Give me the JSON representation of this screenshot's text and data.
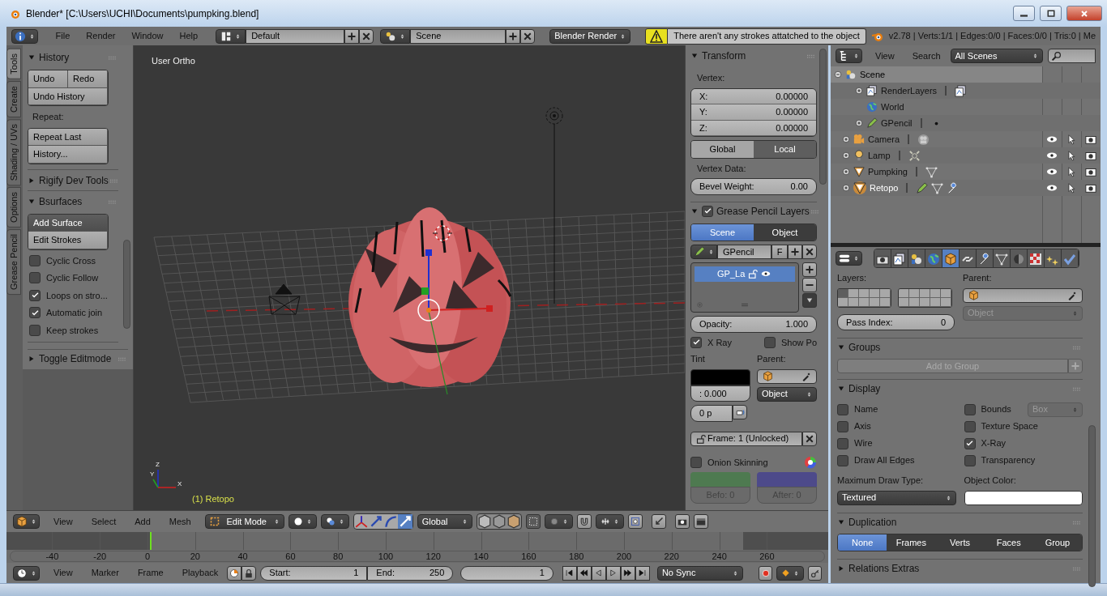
{
  "window": {
    "title": "Blender* [C:\\Users\\UCHI\\Documents\\pumpking.blend]"
  },
  "info_header": {
    "menus": [
      "File",
      "Render",
      "Window",
      "Help"
    ],
    "layout": "Default",
    "scene": "Scene",
    "engine": "Blender Render",
    "warning": "There aren't any strokes attatched to the object",
    "stats": "v2.78 | Verts:1/1 | Edges:0/0 | Faces:0/0 | Tris:0 | Me"
  },
  "tool_shelf": {
    "tabs": [
      {
        "label": "Tools",
        "selected": true
      },
      {
        "label": "Create",
        "selected": false
      },
      {
        "label": "Shading / UVs",
        "selected": false
      },
      {
        "label": "Options",
        "selected": false
      },
      {
        "label": "Grease Pencil",
        "selected": false
      }
    ],
    "panels": [
      {
        "title": "History",
        "expanded": true,
        "items": [
          {
            "kind": "buttons",
            "rows": [
              [
                "Undo",
                "Redo"
              ],
              [
                "Undo History"
              ]
            ]
          },
          {
            "kind": "label",
            "text": "Repeat:"
          },
          {
            "kind": "buttons",
            "rows": [
              [
                "Repeat Last"
              ],
              [
                "History..."
              ]
            ]
          }
        ]
      },
      {
        "title": "Rigify Dev Tools",
        "expanded": false
      },
      {
        "title": "Bsurfaces",
        "expanded": true,
        "items": [
          {
            "kind": "buttons",
            "rows": [
              [
                "Add Surface"
              ],
              [
                "Edit Strokes"
              ]
            ]
          },
          {
            "kind": "checkbox",
            "label": "Cyclic Cross",
            "checked": false
          },
          {
            "kind": "checkbox",
            "label": "Cyclic Follow",
            "checked": false
          },
          {
            "kind": "checkbox",
            "label": "Loops on stro...",
            "checked": true
          },
          {
            "kind": "checkbox",
            "label": "Automatic join",
            "checked": true
          },
          {
            "kind": "checkbox",
            "label": "Keep strokes",
            "checked": false
          }
        ]
      }
    ],
    "footer_panel": {
      "title": "Toggle Editmode",
      "expanded": false
    }
  },
  "viewport": {
    "view_name": "User Ortho",
    "object_info": "(1) Retopo",
    "axis_labels": [
      "Z",
      "Y",
      "X"
    ]
  },
  "n_panel": {
    "transform": {
      "title": "Transform",
      "expanded": true,
      "vertex_label": "Vertex:",
      "coords": [
        {
          "label": "X:",
          "value": "0.00000"
        },
        {
          "label": "Y:",
          "value": "0.00000"
        },
        {
          "label": "Z:",
          "value": "0.00000"
        }
      ],
      "spaces": [
        {
          "label": "Global",
          "selected": false
        },
        {
          "label": "Local",
          "selected": true
        }
      ],
      "data_label": "Vertex Data:",
      "bevel": {
        "label": "Bevel Weight:",
        "value": "0.00"
      }
    },
    "grease_pencil": {
      "title": "Grease Pencil Layers",
      "expanded": true,
      "checked": true,
      "sources": [
        {
          "label": "Scene",
          "selected": true
        },
        {
          "label": "Object",
          "selected": false
        }
      ],
      "datablock": "GPencil",
      "fake_user": "F",
      "layers": [
        {
          "name": "GP_La",
          "selected": true
        }
      ],
      "opacity": {
        "label": "Opacity:",
        "value": "1.000"
      },
      "xray": {
        "label": "X Ray",
        "checked": true
      },
      "show_points": {
        "label": "Show Po",
        "checked": false
      },
      "tint_label": "Tint",
      "tint_value": ": 0.000",
      "parent_label": "Parent:",
      "parent_type": "Object",
      "thickness": "0 p",
      "frame": "Frame: 1 (Unlocked)",
      "onion": {
        "label": "Onion Skinning",
        "checked": false
      },
      "ghosts": [
        {
          "label": "Befo: 0",
          "color": "#4e7a50"
        },
        {
          "label": "After: 0",
          "color": "#4d4a8a"
        }
      ]
    }
  },
  "outliner": {
    "menus": [
      "View",
      "Search"
    ],
    "filter": "All Scenes",
    "tree": [
      {
        "name": "Scene",
        "kind": "scene",
        "expanded": true,
        "children": [
          {
            "name": "RenderLayers",
            "kind": "render_layers",
            "expandable": true,
            "selected": false,
            "grease_pencil": false,
            "modifiers": false
          },
          {
            "name": "World",
            "kind": "world",
            "expandable": false,
            "selected": false,
            "grease_pencil": false,
            "modifiers": false
          },
          {
            "name": "GPencil",
            "kind": "gpencil",
            "expandable": true,
            "selected": false,
            "grease_pencil": false,
            "modifiers": false
          },
          {
            "name": "Camera",
            "kind": "camera",
            "expandable": true,
            "selected": false,
            "grease_pencil": false,
            "modifiers": false
          },
          {
            "name": "Lamp",
            "kind": "lamp",
            "expandable": true,
            "selected": false,
            "grease_pencil": false,
            "modifiers": false
          },
          {
            "name": "Pumpking",
            "kind": "mesh",
            "expandable": true,
            "selected": false,
            "grease_pencil": false,
            "modifiers": false
          },
          {
            "name": "Retopo",
            "kind": "mesh",
            "expandable": true,
            "selected": true,
            "grease_pencil": true,
            "modifiers": true
          }
        ]
      }
    ]
  },
  "properties": {
    "tabs": [
      {
        "kind": "render",
        "selected": false
      },
      {
        "kind": "layers",
        "selected": false
      },
      {
        "kind": "scene",
        "selected": false
      },
      {
        "kind": "world",
        "selected": false
      },
      {
        "kind": "object",
        "selected": true
      },
      {
        "kind": "constraints",
        "selected": false
      },
      {
        "kind": "modifiers",
        "selected": false
      },
      {
        "kind": "data",
        "selected": false
      },
      {
        "kind": "material",
        "selected": false
      },
      {
        "kind": "texture",
        "selected": false
      },
      {
        "kind": "particles",
        "selected": false
      },
      {
        "kind": "physics",
        "selected": false
      }
    ],
    "relations": {
      "layers_label": "Layers:",
      "parent_label": "Parent:",
      "parent_type": "Object",
      "pass_index": {
        "label": "Pass Index:",
        "value": "0"
      }
    },
    "groups": {
      "title": "Groups",
      "expanded": true,
      "add_label": "Add to Group"
    },
    "display": {
      "title": "Display",
      "expanded": true,
      "options": [
        {
          "label": "Name",
          "checked": false
        },
        {
          "label": "Bounds",
          "checked": false,
          "dropdown": "Box"
        },
        {
          "label": "Axis",
          "checked": false
        },
        {
          "label": "Texture Space",
          "checked": false
        },
        {
          "label": "Wire",
          "checked": false
        },
        {
          "label": "X-Ray",
          "checked": true
        },
        {
          "label": "Draw All Edges",
          "checked": false
        },
        {
          "label": "Transparency",
          "checked": false
        }
      ],
      "draw_type_label": "Maximum Draw Type:",
      "draw_type": "Textured",
      "color_label": "Object Color:"
    },
    "duplication": {
      "title": "Duplication",
      "expanded": true,
      "modes": [
        {
          "label": "None",
          "selected": true
        },
        {
          "label": "Frames",
          "selected": false
        },
        {
          "label": "Verts",
          "selected": false
        },
        {
          "label": "Faces",
          "selected": false
        },
        {
          "label": "Group",
          "selected": false
        }
      ]
    },
    "next_panel": {
      "title": "Relations Extras",
      "expanded": false
    }
  },
  "view3d_header": {
    "menus": [
      "View",
      "Select",
      "Add",
      "Mesh"
    ],
    "mode": "Edit Mode",
    "orientation": "Global"
  },
  "timeline": {
    "frames": [
      "-40",
      "-20",
      "0",
      "20",
      "40",
      "60",
      "80",
      "100",
      "120",
      "140",
      "160",
      "180",
      "200",
      "220",
      "240",
      "260"
    ],
    "menus": [
      "View",
      "Marker",
      "Frame",
      "Playback"
    ],
    "start": {
      "label": "Start:",
      "value": "1"
    },
    "end": {
      "label": "End:",
      "value": "250"
    },
    "current": "1",
    "sync": "No Sync"
  }
}
